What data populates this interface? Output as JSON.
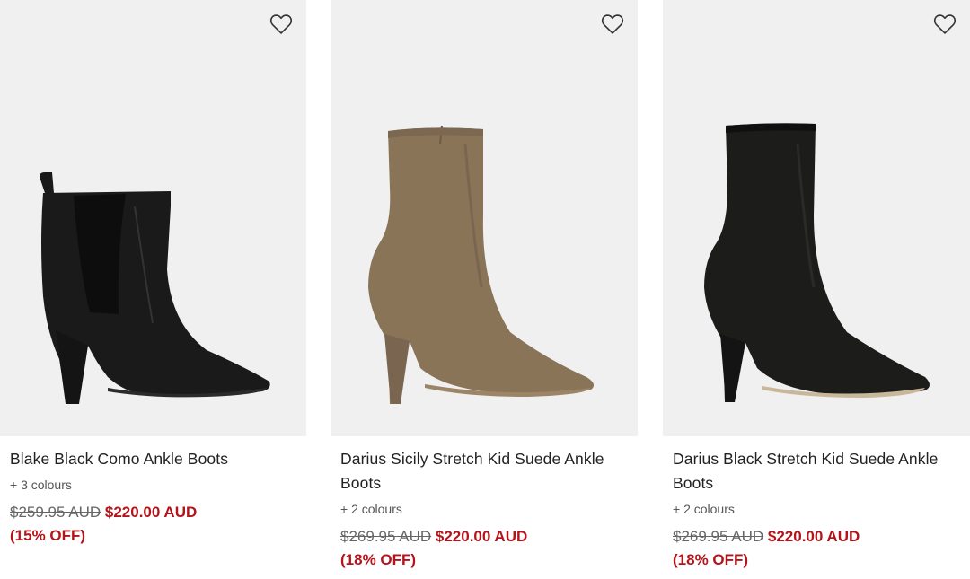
{
  "products": [
    {
      "title": "Blake Black Como Ankle Boots",
      "colours": "+ 3 colours",
      "was_price": "$259.95 AUD",
      "now_price": "$220.00 AUD",
      "discount": "(15% OFF)",
      "boot_color": "#1a1a1a"
    },
    {
      "title": "Darius Sicily Stretch Kid Suede Ankle Boots",
      "colours": "+ 2 colours",
      "was_price": "$269.95 AUD",
      "now_price": "$220.00 AUD",
      "discount": "(18% OFF)",
      "boot_color": "#8a7458"
    },
    {
      "title": "Darius Black Stretch Kid Suede Ankle Boots",
      "colours": "+ 2 colours",
      "was_price": "$269.95 AUD",
      "now_price": "$220.00 AUD",
      "discount": "(18% OFF)",
      "boot_color": "#1c1c1a"
    }
  ],
  "colors": {
    "image_bg": "#f0f0f0",
    "sale_red": "#b3141b",
    "text": "#222222"
  },
  "icons": {
    "wishlist": "heart-outline-icon"
  }
}
